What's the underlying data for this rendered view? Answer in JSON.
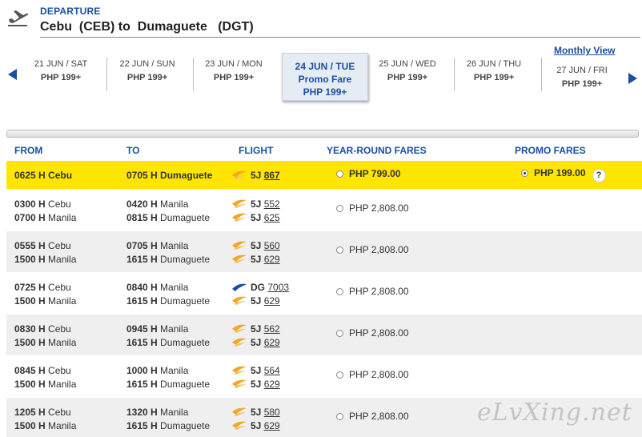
{
  "header": {
    "departure_label": "DEPARTURE",
    "route": "Cebu  (CEB) to  Dumaguete   (DGT)"
  },
  "dates": [
    {
      "date": "21 JUN / SAT",
      "price": "PHP 199+"
    },
    {
      "date": "22 JUN / SUN",
      "price": "PHP 199+"
    },
    {
      "date": "23 JUN / MON",
      "price": "PHP 199+"
    },
    {
      "date": "24 JUN / TUE",
      "note": "Promo Fare",
      "price": "PHP  199+",
      "selected": true
    },
    {
      "date": "25 JUN / WED",
      "price": "PHP 199+"
    },
    {
      "date": "26 JUN / THU",
      "price": "PHP 199+"
    },
    {
      "date": "27 JUN / FRI",
      "price": "PHP 199+"
    }
  ],
  "monthly_view": "Monthly View",
  "columns": {
    "from": "FROM",
    "to": "TO",
    "flight": "FLIGHT",
    "year_round": "YEAR-ROUND FARES",
    "promo": "PROMO FARES"
  },
  "rows": [
    {
      "dep1": "0625 H",
      "from1": "Cebu",
      "arr1": "0705 H",
      "to1": "Dumaguete",
      "fl1_code": "5J",
      "fl1_no": "867",
      "fare": "PHP  799.00",
      "promo": "PHP  199.00",
      "help": "?"
    },
    {
      "dep1": "0300 H",
      "from1": "Cebu",
      "dep2": "0700 H",
      "from2": "Manila",
      "arr1": "0420 H",
      "to1": "Manila",
      "arr2": "0815 H",
      "to2": "Dumaguete",
      "fl1_code": "5J",
      "fl1_no": "552",
      "fl2_code": "5J",
      "fl2_no": "625",
      "fare": "PHP  2,808.00"
    },
    {
      "dep1": "0555 H",
      "from1": "Cebu",
      "dep2": "1500 H",
      "from2": "Manila",
      "arr1": "0705 H",
      "to1": "Manila",
      "arr2": "1615 H",
      "to2": "Dumaguete",
      "fl1_code": "5J",
      "fl1_no": "560",
      "fl2_code": "5J",
      "fl2_no": "629",
      "fare": "PHP  2,808.00"
    },
    {
      "dep1": "0725 H",
      "from1": "Cebu",
      "dep2": "1500 H",
      "from2": "Manila",
      "arr1": "0840 H",
      "to1": "Manila",
      "arr2": "1615 H",
      "to2": "Dumaguete",
      "fl1_code": "DG",
      "fl1_no": "7003",
      "fl2_code": "5J",
      "fl2_no": "629",
      "fare": "PHP  2,808.00"
    },
    {
      "dep1": "0830 H",
      "from1": "Cebu",
      "dep2": "1500 H",
      "from2": "Manila",
      "arr1": "0945 H",
      "to1": "Manila",
      "arr2": "1615 H",
      "to2": "Dumaguete",
      "fl1_code": "5J",
      "fl1_no": "562",
      "fl2_code": "5J",
      "fl2_no": "629",
      "fare": "PHP  2,808.00"
    },
    {
      "dep1": "0845 H",
      "from1": "Cebu",
      "dep2": "1500 H",
      "from2": "Manila",
      "arr1": "1000 H",
      "to1": "Manila",
      "arr2": "1615 H",
      "to2": "Dumaguete",
      "fl1_code": "5J",
      "fl1_no": "564",
      "fl2_code": "5J",
      "fl2_no": "629",
      "fare": "PHP  2,808.00"
    },
    {
      "dep1": "1205 H",
      "from1": "Cebu",
      "dep2": "1500 H",
      "from2": "Manila",
      "arr1": "1320 H",
      "to1": "Manila",
      "arr2": "1615 H",
      "to2": "Dumaguete",
      "fl1_code": "5J",
      "fl1_no": "580",
      "fl2_code": "5J",
      "fl2_no": "629",
      "fare": "PHP  2,808.00"
    }
  ],
  "watermark": "eLvXing.net",
  "colors": {
    "accent": "#1a4fa0",
    "highlight": "#ffe500",
    "alt_row": "#efefef",
    "cebu_logo": "#f5a623",
    "dg_logo": "#1a4fa0"
  }
}
